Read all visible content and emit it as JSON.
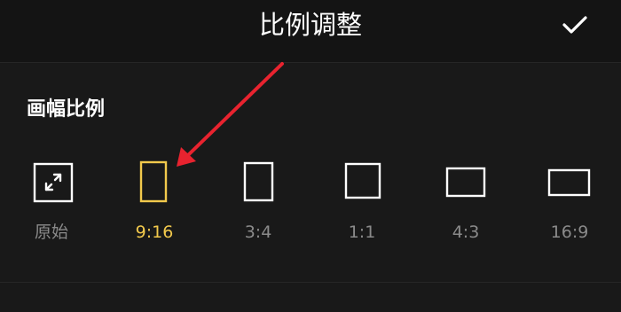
{
  "header": {
    "title": "比例调整",
    "confirm_icon": "check-icon"
  },
  "section": {
    "title": "画幅比例"
  },
  "ratios": [
    {
      "label": "原始",
      "icon": "original-ratio-icon",
      "selected": false
    },
    {
      "label": "9:16",
      "icon": "ratio-9-16-icon",
      "selected": true
    },
    {
      "label": "3:4",
      "icon": "ratio-3-4-icon",
      "selected": false
    },
    {
      "label": "1:1",
      "icon": "ratio-1-1-icon",
      "selected": false
    },
    {
      "label": "4:3",
      "icon": "ratio-4-3-icon",
      "selected": false
    },
    {
      "label": "16:9",
      "icon": "ratio-16-9-icon",
      "selected": false
    }
  ],
  "colors": {
    "background": "#191919",
    "selected": "#f2c94c",
    "unselected_label": "#8a8a8a",
    "icon": "#ffffff",
    "annotation_arrow": "#e8232f"
  }
}
